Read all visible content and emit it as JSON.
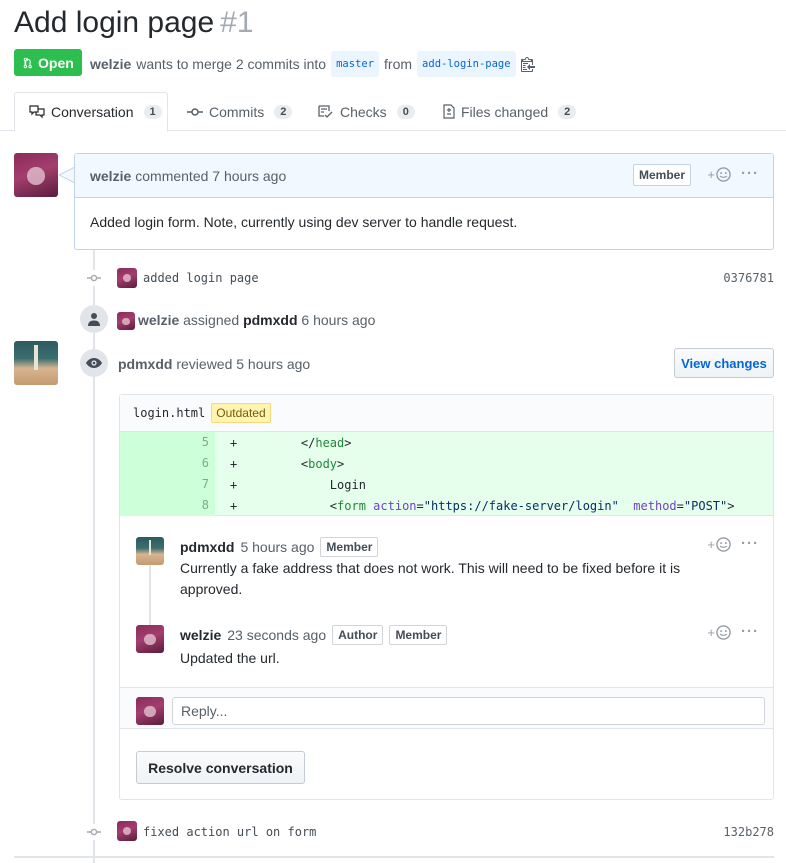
{
  "pr": {
    "title": "Add login page",
    "number": "#1",
    "state": "Open",
    "author": "welzie",
    "meta_text": "wants to merge 2 commits into",
    "base": "master",
    "from": "from",
    "head": "add-login-page"
  },
  "tabs": [
    {
      "label": "Conversation",
      "count": "1",
      "icon": "conversation-icon"
    },
    {
      "label": "Commits",
      "count": "2",
      "icon": "commit-icon"
    },
    {
      "label": "Checks",
      "count": "0",
      "icon": "checks-icon"
    },
    {
      "label": "Files changed",
      "count": "2",
      "icon": "file-diff-icon"
    }
  ],
  "comment1": {
    "author": "welzie",
    "action": "commented 7 hours ago",
    "badge": "Member",
    "body": "Added login form. Note, currently using dev server to handle request."
  },
  "commit1": {
    "message": "added login page",
    "sha": "0376781"
  },
  "assign": {
    "actor": "welzie",
    "text": "assigned",
    "assignee": "pdmxdd",
    "time": "6 hours ago"
  },
  "review": {
    "author": "pdmxdd",
    "text": "reviewed 5 hours ago",
    "view_changes": "View changes",
    "file": "login.html",
    "outdated": "Outdated",
    "diff": [
      {
        "n": "5",
        "sign": "+",
        "code": "    </head>"
      },
      {
        "n": "6",
        "sign": "+",
        "code": "    <body>"
      },
      {
        "n": "7",
        "sign": "+",
        "code": "        Login"
      },
      {
        "n": "8",
        "sign": "+",
        "code": "        <form action=\"https://fake-server/login\"  method=\"POST\">"
      }
    ],
    "comments": [
      {
        "author": "pdmxdd",
        "time": "5 hours ago",
        "badges": [
          "Member"
        ],
        "body": "Currently a fake address that does not work. This will need to be fixed before it is approved."
      },
      {
        "author": "welzie",
        "time": "23 seconds ago",
        "badges": [
          "Author",
          "Member"
        ],
        "body": "Updated the url."
      }
    ],
    "reply_placeholder": "Reply...",
    "resolve": "Resolve conversation"
  },
  "commit2": {
    "message": "fixed action url on form",
    "sha": "132b278"
  },
  "react_label": "+"
}
